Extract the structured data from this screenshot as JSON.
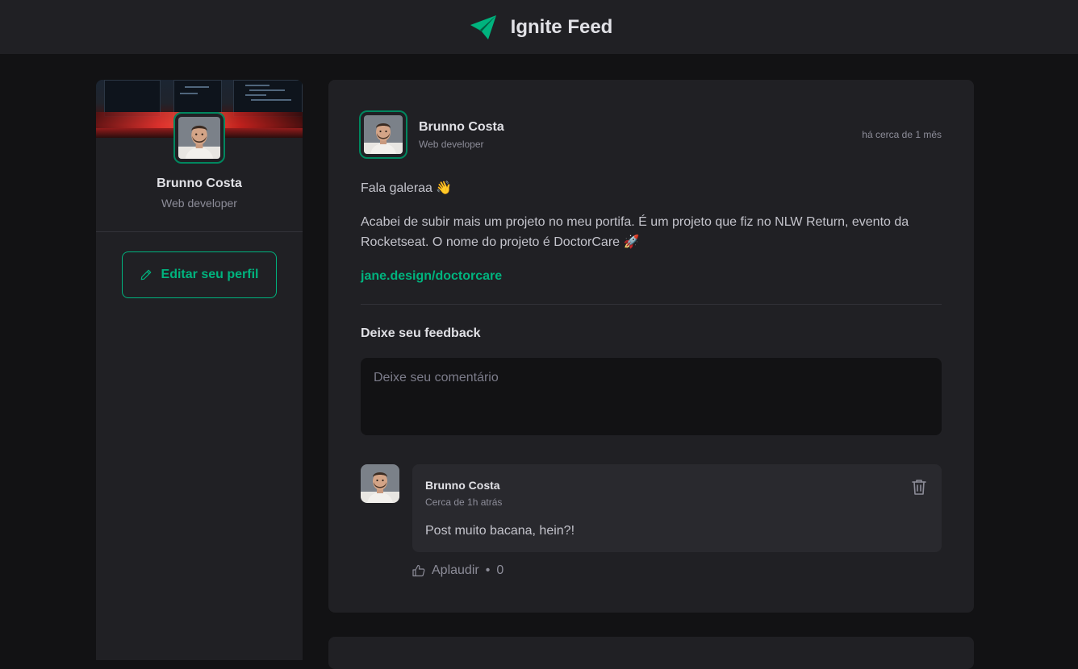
{
  "header": {
    "title": "Ignite Feed",
    "logo_icon": "paper-plane-logo-icon"
  },
  "sidebar": {
    "name": "Brunno Costa",
    "role": "Web developer",
    "edit_label": "Editar seu perfil",
    "edit_icon": "pencil-icon"
  },
  "post": {
    "author": {
      "name": "Brunno Costa",
      "role": "Web developer"
    },
    "published": "há cerca de 1 mês",
    "content": {
      "greeting": "Fala galeraa 👋",
      "body": "Acabei de subir mais um projeto no meu portifa. É um projeto que fiz no NLW Return, evento da Rocketseat. O nome do projeto é DoctorCare 🚀",
      "link": "jane.design/doctorcare"
    },
    "feedback_label": "Deixe seu feedback",
    "comment_placeholder": "Deixe seu comentário",
    "comments": [
      {
        "author": "Brunno Costa",
        "time": "Cerca de 1h atrás",
        "text": "Post muito bacana, hein?!",
        "applaud_label": "Aplaudir",
        "applaud_separator": "•",
        "applaud_count": "0"
      }
    ]
  },
  "colors": {
    "brand": "#00b37e",
    "brand_dark": "#00875f",
    "background": "#121214",
    "surface": "#202024"
  }
}
